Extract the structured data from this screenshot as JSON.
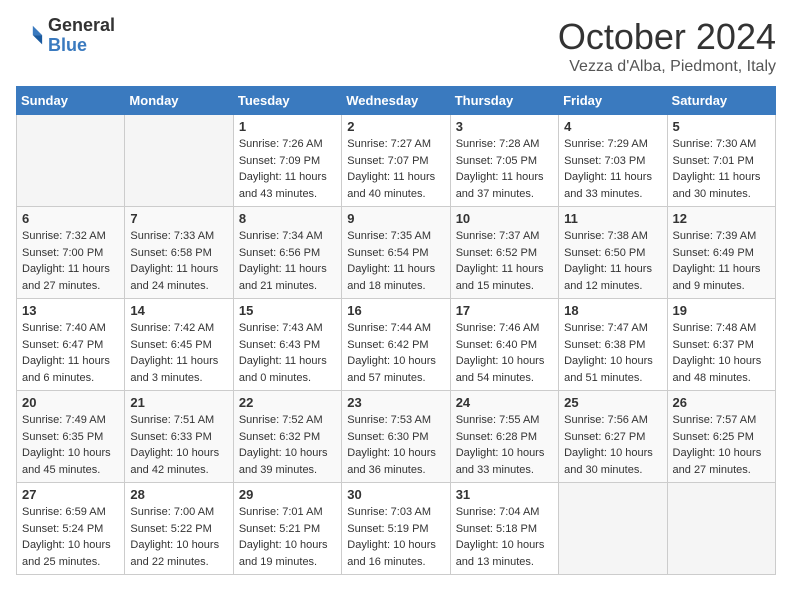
{
  "logo": {
    "general": "General",
    "blue": "Blue"
  },
  "title": "October 2024",
  "location": "Vezza d'Alba, Piedmont, Italy",
  "days_of_week": [
    "Sunday",
    "Monday",
    "Tuesday",
    "Wednesday",
    "Thursday",
    "Friday",
    "Saturday"
  ],
  "weeks": [
    [
      {
        "day": "",
        "empty": true
      },
      {
        "day": "",
        "empty": true
      },
      {
        "day": "1",
        "sunrise": "Sunrise: 7:26 AM",
        "sunset": "Sunset: 7:09 PM",
        "daylight": "Daylight: 11 hours and 43 minutes."
      },
      {
        "day": "2",
        "sunrise": "Sunrise: 7:27 AM",
        "sunset": "Sunset: 7:07 PM",
        "daylight": "Daylight: 11 hours and 40 minutes."
      },
      {
        "day": "3",
        "sunrise": "Sunrise: 7:28 AM",
        "sunset": "Sunset: 7:05 PM",
        "daylight": "Daylight: 11 hours and 37 minutes."
      },
      {
        "day": "4",
        "sunrise": "Sunrise: 7:29 AM",
        "sunset": "Sunset: 7:03 PM",
        "daylight": "Daylight: 11 hours and 33 minutes."
      },
      {
        "day": "5",
        "sunrise": "Sunrise: 7:30 AM",
        "sunset": "Sunset: 7:01 PM",
        "daylight": "Daylight: 11 hours and 30 minutes."
      }
    ],
    [
      {
        "day": "6",
        "sunrise": "Sunrise: 7:32 AM",
        "sunset": "Sunset: 7:00 PM",
        "daylight": "Daylight: 11 hours and 27 minutes."
      },
      {
        "day": "7",
        "sunrise": "Sunrise: 7:33 AM",
        "sunset": "Sunset: 6:58 PM",
        "daylight": "Daylight: 11 hours and 24 minutes."
      },
      {
        "day": "8",
        "sunrise": "Sunrise: 7:34 AM",
        "sunset": "Sunset: 6:56 PM",
        "daylight": "Daylight: 11 hours and 21 minutes."
      },
      {
        "day": "9",
        "sunrise": "Sunrise: 7:35 AM",
        "sunset": "Sunset: 6:54 PM",
        "daylight": "Daylight: 11 hours and 18 minutes."
      },
      {
        "day": "10",
        "sunrise": "Sunrise: 7:37 AM",
        "sunset": "Sunset: 6:52 PM",
        "daylight": "Daylight: 11 hours and 15 minutes."
      },
      {
        "day": "11",
        "sunrise": "Sunrise: 7:38 AM",
        "sunset": "Sunset: 6:50 PM",
        "daylight": "Daylight: 11 hours and 12 minutes."
      },
      {
        "day": "12",
        "sunrise": "Sunrise: 7:39 AM",
        "sunset": "Sunset: 6:49 PM",
        "daylight": "Daylight: 11 hours and 9 minutes."
      }
    ],
    [
      {
        "day": "13",
        "sunrise": "Sunrise: 7:40 AM",
        "sunset": "Sunset: 6:47 PM",
        "daylight": "Daylight: 11 hours and 6 minutes."
      },
      {
        "day": "14",
        "sunrise": "Sunrise: 7:42 AM",
        "sunset": "Sunset: 6:45 PM",
        "daylight": "Daylight: 11 hours and 3 minutes."
      },
      {
        "day": "15",
        "sunrise": "Sunrise: 7:43 AM",
        "sunset": "Sunset: 6:43 PM",
        "daylight": "Daylight: 11 hours and 0 minutes."
      },
      {
        "day": "16",
        "sunrise": "Sunrise: 7:44 AM",
        "sunset": "Sunset: 6:42 PM",
        "daylight": "Daylight: 10 hours and 57 minutes."
      },
      {
        "day": "17",
        "sunrise": "Sunrise: 7:46 AM",
        "sunset": "Sunset: 6:40 PM",
        "daylight": "Daylight: 10 hours and 54 minutes."
      },
      {
        "day": "18",
        "sunrise": "Sunrise: 7:47 AM",
        "sunset": "Sunset: 6:38 PM",
        "daylight": "Daylight: 10 hours and 51 minutes."
      },
      {
        "day": "19",
        "sunrise": "Sunrise: 7:48 AM",
        "sunset": "Sunset: 6:37 PM",
        "daylight": "Daylight: 10 hours and 48 minutes."
      }
    ],
    [
      {
        "day": "20",
        "sunrise": "Sunrise: 7:49 AM",
        "sunset": "Sunset: 6:35 PM",
        "daylight": "Daylight: 10 hours and 45 minutes."
      },
      {
        "day": "21",
        "sunrise": "Sunrise: 7:51 AM",
        "sunset": "Sunset: 6:33 PM",
        "daylight": "Daylight: 10 hours and 42 minutes."
      },
      {
        "day": "22",
        "sunrise": "Sunrise: 7:52 AM",
        "sunset": "Sunset: 6:32 PM",
        "daylight": "Daylight: 10 hours and 39 minutes."
      },
      {
        "day": "23",
        "sunrise": "Sunrise: 7:53 AM",
        "sunset": "Sunset: 6:30 PM",
        "daylight": "Daylight: 10 hours and 36 minutes."
      },
      {
        "day": "24",
        "sunrise": "Sunrise: 7:55 AM",
        "sunset": "Sunset: 6:28 PM",
        "daylight": "Daylight: 10 hours and 33 minutes."
      },
      {
        "day": "25",
        "sunrise": "Sunrise: 7:56 AM",
        "sunset": "Sunset: 6:27 PM",
        "daylight": "Daylight: 10 hours and 30 minutes."
      },
      {
        "day": "26",
        "sunrise": "Sunrise: 7:57 AM",
        "sunset": "Sunset: 6:25 PM",
        "daylight": "Daylight: 10 hours and 27 minutes."
      }
    ],
    [
      {
        "day": "27",
        "sunrise": "Sunrise: 6:59 AM",
        "sunset": "Sunset: 5:24 PM",
        "daylight": "Daylight: 10 hours and 25 minutes."
      },
      {
        "day": "28",
        "sunrise": "Sunrise: 7:00 AM",
        "sunset": "Sunset: 5:22 PM",
        "daylight": "Daylight: 10 hours and 22 minutes."
      },
      {
        "day": "29",
        "sunrise": "Sunrise: 7:01 AM",
        "sunset": "Sunset: 5:21 PM",
        "daylight": "Daylight: 10 hours and 19 minutes."
      },
      {
        "day": "30",
        "sunrise": "Sunrise: 7:03 AM",
        "sunset": "Sunset: 5:19 PM",
        "daylight": "Daylight: 10 hours and 16 minutes."
      },
      {
        "day": "31",
        "sunrise": "Sunrise: 7:04 AM",
        "sunset": "Sunset: 5:18 PM",
        "daylight": "Daylight: 10 hours and 13 minutes."
      },
      {
        "day": "",
        "empty": true
      },
      {
        "day": "",
        "empty": true
      }
    ]
  ]
}
